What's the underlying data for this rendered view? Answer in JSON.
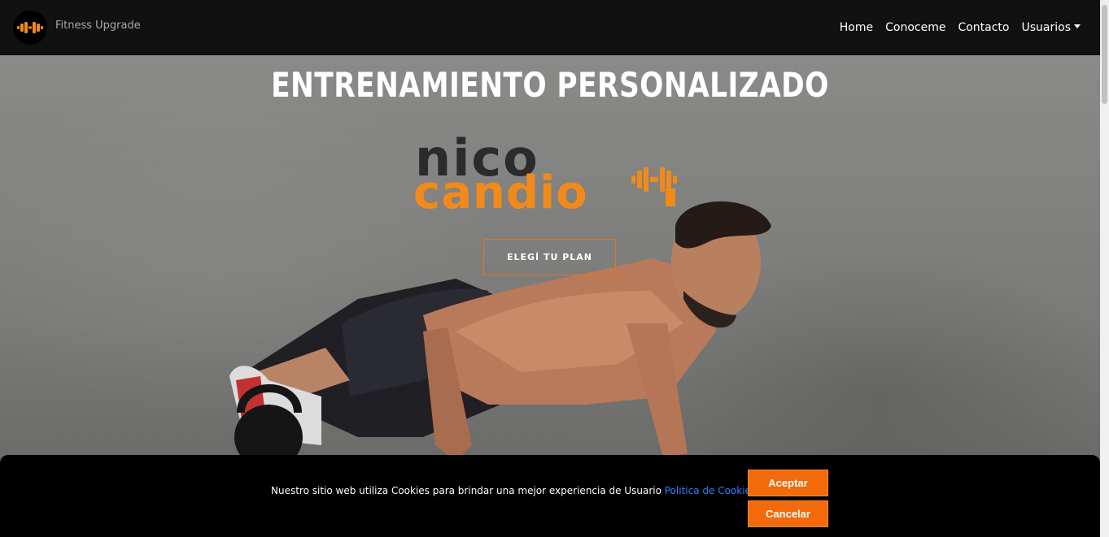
{
  "nav": {
    "brand": "Fitness Upgrade",
    "links": [
      "Home",
      "Conoceme",
      "Contacto",
      "Usuarios"
    ]
  },
  "hero": {
    "title": "ENTRENAMIENTO PERSONALIZADO",
    "logo_line1": "nico",
    "logo_line2": "candio",
    "cta": "ELEGÍ TU PLAN"
  },
  "cookie": {
    "text": "Nuestro sitio web utiliza Cookies para brindar una mejor experiencia de Usuario ",
    "link": "Politica de Cookies.",
    "accept": "Aceptar",
    "cancel": "Cancelar"
  },
  "colors": {
    "accent": "#f26a09",
    "navbar": "#111111",
    "link": "#2f80ff"
  }
}
